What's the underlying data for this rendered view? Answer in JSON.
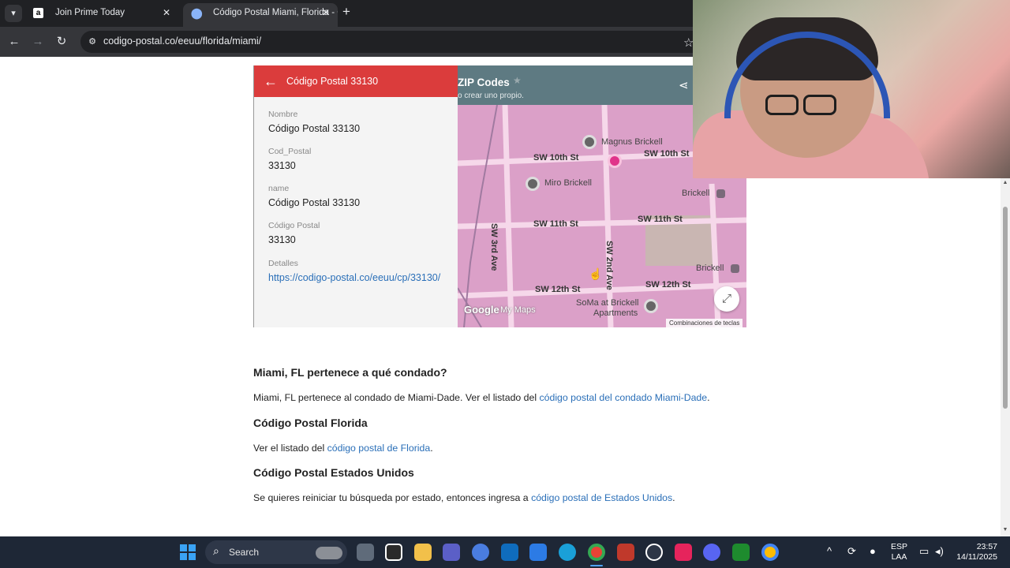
{
  "browser": {
    "tabs": [
      {
        "title": "Join Prime Today",
        "favicon": "a"
      },
      {
        "title": "Código Postal Miami, Florida - C"
      }
    ],
    "url": "codigo-postal.co/eeuu/florida/miami/"
  },
  "panel": {
    "title": "Código Postal 33130",
    "fields": [
      {
        "label": "Nombre",
        "value": "Código Postal 33130"
      },
      {
        "label": "Cod_Postal",
        "value": "33130"
      },
      {
        "label": "name",
        "value": "Código Postal 33130"
      },
      {
        "label": "Código Postal",
        "value": "33130"
      },
      {
        "label": "Detalles",
        "value": "https://codigo-postal.co/eeuu/cp/33130/"
      }
    ]
  },
  "map": {
    "title": "ZIP Codes",
    "subtitle": "o crear uno propio.",
    "streets": [
      "SW 10th St",
      "SW 10th St",
      "SW 11th St",
      "SW 11th St",
      "SW 3rd Ave",
      "SW 2nd Ave",
      "SW 12th St",
      "SW 12th St"
    ],
    "pois": [
      "Magnus Brickell",
      "Miro Brickell",
      "Brickell",
      "Brickell",
      "SoMa at Brickell",
      "Apartments"
    ],
    "google": "Google",
    "mymaps": "My Maps",
    "shortcuts": "Combinaciones de teclas"
  },
  "article": {
    "h1": "Miami, FL pertenece a qué condado?",
    "p1_text": "Miami, FL pertenece al condado de Miami-Dade. Ver el listado del ",
    "p1_link": "código postal del condado Miami-Dade",
    "h2": "Código Postal Florida",
    "p2_text": "Ver el listado del ",
    "p2_link": "código postal de Florida",
    "h3": "Código Postal Estados Unidos",
    "p3_text": "Se quieres reiniciar tu búsqueda por estado, entonces ingresa a ",
    "p3_link": "código postal de Estados Unidos",
    "period": "."
  },
  "taskbar": {
    "search_placeholder": "Search",
    "lang_top": "ESP",
    "lang_bottom": "LAA",
    "time": "23:57",
    "date": "14/11/2025"
  }
}
